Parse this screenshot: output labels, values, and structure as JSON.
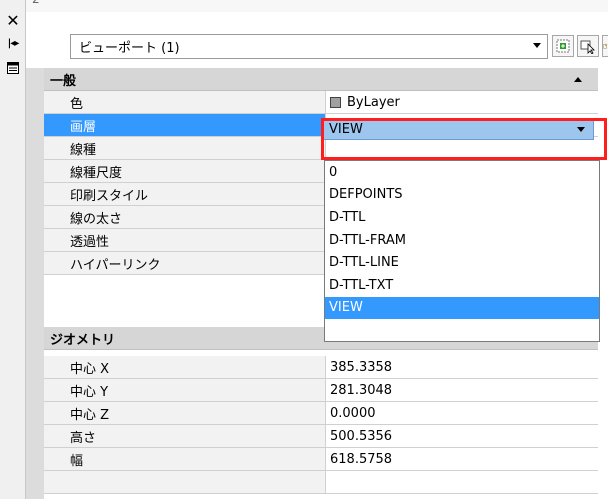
{
  "palette": {
    "title_cropped": "2",
    "object_selector": "ビューポート (1)"
  },
  "categories": {
    "general": "一般",
    "geometry": "ジオメトリ"
  },
  "general_rows": [
    {
      "label": "色",
      "value": "ByLayer"
    },
    {
      "label": "画層",
      "value": "VIEW"
    },
    {
      "label": "線種",
      "value": ""
    },
    {
      "label": "線種尺度",
      "value": ""
    },
    {
      "label": "印刷スタイル",
      "value": ""
    },
    {
      "label": "線の太さ",
      "value": ""
    },
    {
      "label": "透過性",
      "value": ""
    },
    {
      "label": "ハイパーリンク",
      "value": ""
    }
  ],
  "geometry_rows": [
    {
      "label": "中心 X",
      "value": "385.3358"
    },
    {
      "label": "中心 Y",
      "value": "281.3048"
    },
    {
      "label": "中心 Z",
      "value": "0.0000"
    },
    {
      "label": "高さ",
      "value": "500.5356"
    },
    {
      "label": "幅",
      "value": "618.5758"
    }
  ],
  "layer_dropdown": {
    "selected": "VIEW",
    "options": [
      "0",
      "DEFPOINTS",
      "D-TTL",
      "D-TTL-FRAM",
      "D-TTL-LINE",
      "D-TTL-TXT",
      "VIEW"
    ]
  },
  "colors": {
    "selection_blue": "#3399ff",
    "highlight_red": "#ff1e1e",
    "combo_blue": "#9dc6ee"
  }
}
